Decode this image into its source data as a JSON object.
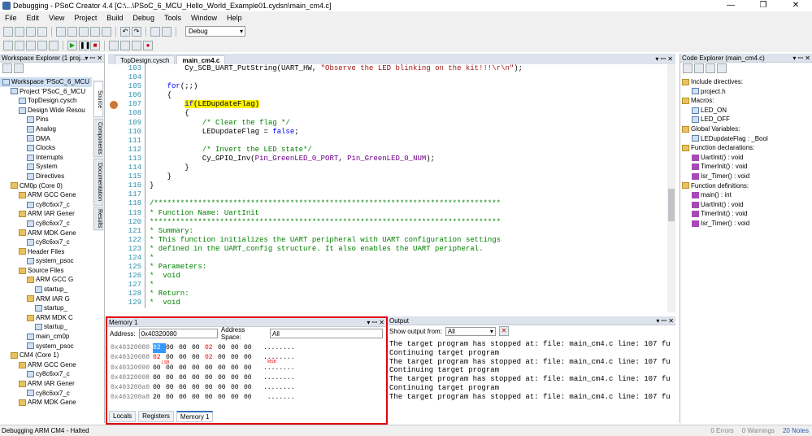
{
  "window": {
    "title": "Debugging - PSoC Creator 4.4  [C:\\...\\PSoC_6_MCU_Hello_World_Example01.cydsn\\main_cm4.c]"
  },
  "menu": [
    "File",
    "Edit",
    "View",
    "Project",
    "Build",
    "Debug",
    "Tools",
    "Window",
    "Help"
  ],
  "toolbar": {
    "config": "Debug"
  },
  "workspace": {
    "title": "Workspace Explorer (1 proj...",
    "items": [
      {
        "label": "Workspace 'PSoC_6_MCU",
        "indent": 0,
        "icon": "c"
      },
      {
        "label": "Project 'PSoC_6_MCU",
        "indent": 1,
        "icon": "c"
      },
      {
        "label": "TopDesign.cysch",
        "indent": 2,
        "icon": "c"
      },
      {
        "label": "Design Wide Resou",
        "indent": 2,
        "icon": "c"
      },
      {
        "label": "Pins",
        "indent": 3,
        "icon": "c"
      },
      {
        "label": "Analog",
        "indent": 3,
        "icon": "c"
      },
      {
        "label": "DMA",
        "indent": 3,
        "icon": "c"
      },
      {
        "label": "Clocks",
        "indent": 3,
        "icon": "c"
      },
      {
        "label": "Interrupts",
        "indent": 3,
        "icon": "c"
      },
      {
        "label": "System",
        "indent": 3,
        "icon": "c"
      },
      {
        "label": "Directives",
        "indent": 3,
        "icon": "c"
      },
      {
        "label": "CM0p (Core 0)",
        "indent": 1,
        "icon": "f"
      },
      {
        "label": "ARM GCC Gene",
        "indent": 2,
        "icon": "f"
      },
      {
        "label": "cy8c6xx7_c",
        "indent": 3,
        "icon": "c"
      },
      {
        "label": "ARM IAR Gener",
        "indent": 2,
        "icon": "f"
      },
      {
        "label": "cy8c6xx7_c",
        "indent": 3,
        "icon": "c"
      },
      {
        "label": "ARM MDK Gene",
        "indent": 2,
        "icon": "f"
      },
      {
        "label": "cy8c6xx7_c",
        "indent": 3,
        "icon": "c"
      },
      {
        "label": "Header Files",
        "indent": 2,
        "icon": "f"
      },
      {
        "label": "system_psoc",
        "indent": 3,
        "icon": "c"
      },
      {
        "label": "Source Files",
        "indent": 2,
        "icon": "f"
      },
      {
        "label": "ARM GCC G",
        "indent": 3,
        "icon": "f"
      },
      {
        "label": "startup_",
        "indent": 4,
        "icon": "c"
      },
      {
        "label": "ARM IAR G",
        "indent": 3,
        "icon": "f"
      },
      {
        "label": "startup_",
        "indent": 4,
        "icon": "c"
      },
      {
        "label": "ARM MDK C",
        "indent": 3,
        "icon": "f"
      },
      {
        "label": "startup_",
        "indent": 4,
        "icon": "c"
      },
      {
        "label": "main_cm0p",
        "indent": 3,
        "icon": "c"
      },
      {
        "label": "system_psoc",
        "indent": 3,
        "icon": "c"
      },
      {
        "label": "CM4 (Core 1)",
        "indent": 1,
        "icon": "f"
      },
      {
        "label": "ARM GCC Gene",
        "indent": 2,
        "icon": "f"
      },
      {
        "label": "cy8c6xx7_c",
        "indent": 3,
        "icon": "c"
      },
      {
        "label": "ARM IAR Gener",
        "indent": 2,
        "icon": "f"
      },
      {
        "label": "cy8c6xx7_c",
        "indent": 3,
        "icon": "c"
      },
      {
        "label": "ARM MDK Gene",
        "indent": 2,
        "icon": "f"
      }
    ],
    "sidetabs": [
      "Source",
      "Components",
      "Documentation",
      "Results"
    ]
  },
  "editor": {
    "tabs": [
      "TopDesign.cysch",
      "main_cm4.c"
    ],
    "lines": [
      {
        "n": "103",
        "html": "        Cy_SCB_UART_PutString(<span class=\"cm\"></span>UART_HW, <span class=\"str\">\"Observe the LED blinking on the kit!!!\\r\\n\"</span>);"
      },
      {
        "n": "104",
        "html": ""
      },
      {
        "n": "105",
        "html": "    <span class=\"kw\">for</span>(;;)"
      },
      {
        "n": "106",
        "html": "    {"
      },
      {
        "n": "107",
        "html": "        <span class=\"hl\"><span class=\"kw\">if</span>(LEDupdateFlag)</span>"
      },
      {
        "n": "108",
        "html": "        {"
      },
      {
        "n": "109",
        "html": "            <span class=\"cm\">/* Clear the flag */</span>"
      },
      {
        "n": "110",
        "html": "            LEDupdateFlag = <span class=\"kw\">false</span>;"
      },
      {
        "n": "111",
        "html": ""
      },
      {
        "n": "112",
        "html": "            <span class=\"cm\">/* Invert the LED state*/</span>"
      },
      {
        "n": "113",
        "html": "            Cy_GPIO_Inv(<span style=\"color:#6f008a\">Pin_GreenLED_0_PORT</span>, <span style=\"color:#6f008a\">Pin_GreenLED_0_NUM</span>);"
      },
      {
        "n": "114",
        "html": "        }"
      },
      {
        "n": "115",
        "html": "    }"
      },
      {
        "n": "116",
        "html": "}"
      },
      {
        "n": "117",
        "html": ""
      },
      {
        "n": "118",
        "html": "<span class=\"cm\">/*******************************************************************************</span>"
      },
      {
        "n": "119",
        "html": "<span class=\"cm\">* Function Name: UartInit</span>"
      },
      {
        "n": "120",
        "html": "<span class=\"cm\">********************************************************************************</span>"
      },
      {
        "n": "121",
        "html": "<span class=\"cm\">* Summary:</span>"
      },
      {
        "n": "122",
        "html": "<span class=\"cm\">* This function initializes the UART peripheral with UART configuration settings</span>"
      },
      {
        "n": "123",
        "html": "<span class=\"cm\">* defined in the UART_config structure. It also enables the UART peripheral.</span>"
      },
      {
        "n": "124",
        "html": "<span class=\"cm\">*</span>"
      },
      {
        "n": "125",
        "html": "<span class=\"cm\">* Parameters:</span>"
      },
      {
        "n": "126",
        "html": "<span class=\"cm\">*  void</span>"
      },
      {
        "n": "127",
        "html": "<span class=\"cm\">*</span>"
      },
      {
        "n": "128",
        "html": "<span class=\"cm\">* Return:</span>"
      },
      {
        "n": "129",
        "html": "<span class=\"cm\">*  void</span>"
      }
    ]
  },
  "codeExplorer": {
    "title": "Code Explorer (main_cm4.c)",
    "items": [
      {
        "label": "Include directives:",
        "indent": 0,
        "icon": "f"
      },
      {
        "label": "project.h",
        "indent": 1,
        "icon": "c"
      },
      {
        "label": "Macros:",
        "indent": 0,
        "icon": "f"
      },
      {
        "label": "LED_ON",
        "indent": 1,
        "icon": "c"
      },
      {
        "label": "LED_OFF",
        "indent": 1,
        "icon": "c"
      },
      {
        "label": "Global Variables:",
        "indent": 0,
        "icon": "f"
      },
      {
        "label": "LEDupdateFlag : _Bool",
        "indent": 1,
        "icon": "c"
      },
      {
        "label": "Function declarations:",
        "indent": 0,
        "icon": "f"
      },
      {
        "label": "UartInit() : void",
        "indent": 1,
        "icon": "p"
      },
      {
        "label": "TimerInit() : void",
        "indent": 1,
        "icon": "p"
      },
      {
        "label": "Isr_Timer() : void",
        "indent": 1,
        "icon": "p"
      },
      {
        "label": "Function definitions:",
        "indent": 0,
        "icon": "f"
      },
      {
        "label": "main() : int",
        "indent": 1,
        "icon": "p"
      },
      {
        "label": "UartInit() : void",
        "indent": 1,
        "icon": "p"
      },
      {
        "label": "TimerInit() : void",
        "indent": 1,
        "icon": "p"
      },
      {
        "label": "Isr_Timer() : void",
        "indent": 1,
        "icon": "p"
      }
    ]
  },
  "memory": {
    "title": "Memory 1",
    "address_label": "Address:",
    "address_value": "0x40320080",
    "space_label": "Address Space:",
    "space_value": "All",
    "rows": [
      {
        "addr": "0x40320080",
        "bytes": [
          "02",
          "00",
          "00",
          "00",
          "02",
          "00",
          "00",
          "00"
        ],
        "ascii": "........"
      },
      {
        "addr": "0x40320088",
        "bytes": [
          "02",
          "00",
          "00",
          "00",
          "02",
          "00",
          "00",
          "00"
        ],
        "ascii": "........"
      },
      {
        "addr": "0x40320090",
        "bytes": [
          "00",
          "00",
          "00",
          "00",
          "00",
          "00",
          "00",
          "00"
        ],
        "ascii": "........"
      },
      {
        "addr": "0x40320098",
        "bytes": [
          "00",
          "00",
          "00",
          "00",
          "00",
          "00",
          "00",
          "00"
        ],
        "ascii": "........"
      },
      {
        "addr": "0x403200a0",
        "bytes": [
          "00",
          "00",
          "00",
          "00",
          "00",
          "00",
          "00",
          "00"
        ],
        "ascii": "........"
      },
      {
        "addr": "0x403200a8",
        "bytes": [
          "20",
          "00",
          "00",
          "00",
          "00",
          "00",
          "00",
          "00"
        ],
        "ascii": " ......."
      }
    ],
    "lsb": "LSB",
    "msb": "MSB",
    "tabs": [
      "Locals",
      "Registers",
      "Memory 1"
    ]
  },
  "output": {
    "title": "Output",
    "show_label": "Show output from:",
    "show_value": "All",
    "lines": [
      "The target program has stopped at: file: main_cm4.c line: 107 func",
      "Continuing target program",
      "The target program has stopped at: file: main_cm4.c line: 107 func",
      "Continuing target program",
      "The target program has stopped at: file: main_cm4.c line: 107 func",
      "Continuing target program",
      "The target program has stopped at: file: main_cm4.c line: 107 func"
    ]
  },
  "status": {
    "left": "Debugging ARM CM4 - Halted",
    "errors": "0 Errors",
    "warnings": "0 Warnings",
    "notes": "20 Notes"
  }
}
